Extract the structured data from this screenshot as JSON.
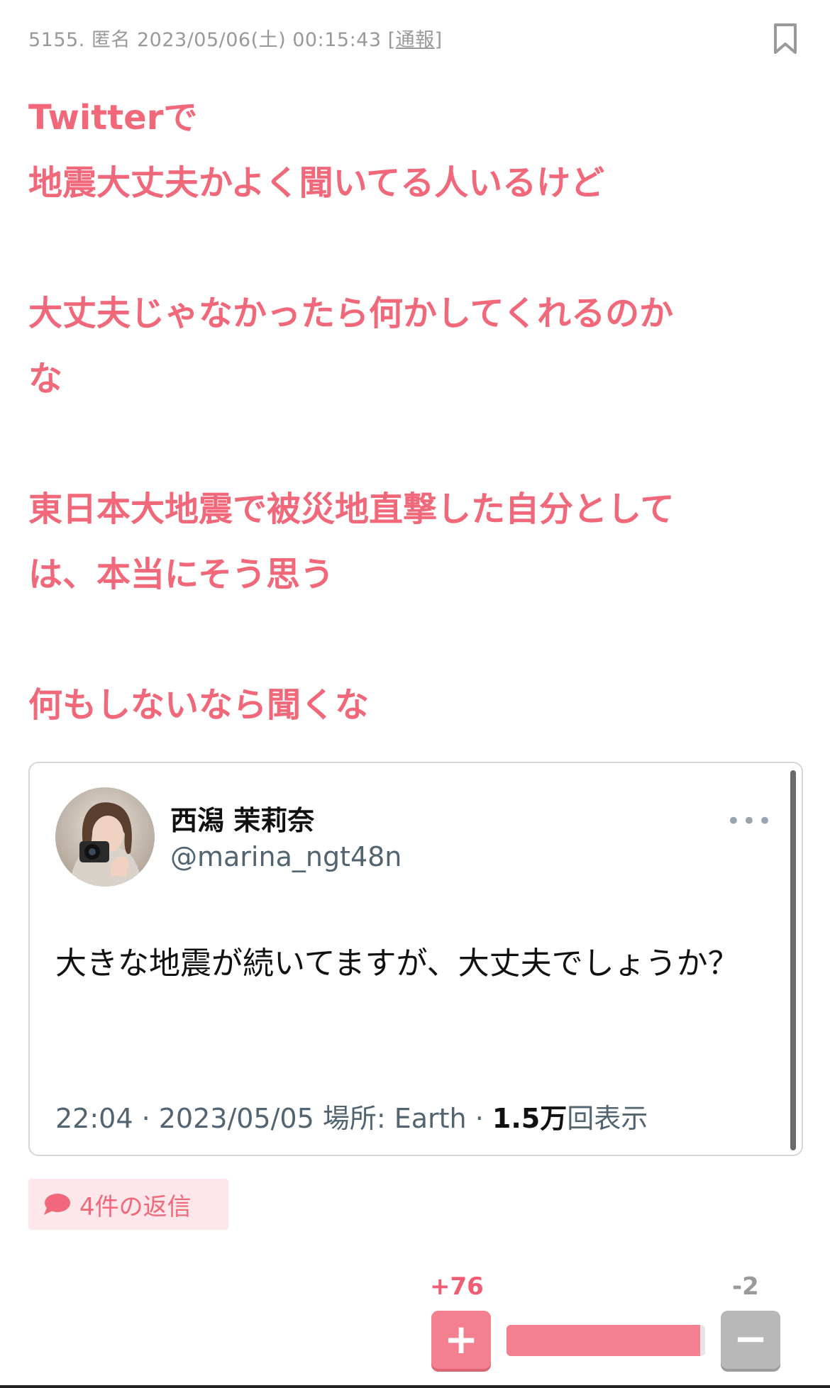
{
  "comment": {
    "number": "5155.",
    "author": "匿名",
    "datetime": "2023/05/06(土) 00:15:43",
    "report_open": "[",
    "report_label": "通報",
    "report_close": "]",
    "body_paragraphs": [
      [
        "Twitterで",
        "地震大丈夫かよく聞いてる人いるけど"
      ],
      [
        "大丈夫じゃなかったら何かしてくれるのか",
        "な"
      ],
      [
        "東日本大地震で被災地直撃した自分として",
        "は、本当にそう思う"
      ],
      [
        "何もしないなら聞くな"
      ]
    ]
  },
  "tweet": {
    "name": "西潟 茉莉奈",
    "handle": "@marina_ngt48n",
    "more_icon": "•••",
    "text": "大きな地震が続いてますが、大丈夫でしょうか？",
    "meta_time": "22:04 · 2023/05/05 場所: Earth · ",
    "meta_views_number": "1.5万",
    "meta_views_label": "回表示"
  },
  "replies": {
    "label": "4件の返信",
    "icon": "speech-bubble-icon"
  },
  "votes": {
    "plus_count": "+76",
    "minus_count": "-2",
    "plus_symbol": "+",
    "minus_symbol": "−",
    "positive_ratio": 0.974
  },
  "colors": {
    "accent": "#f0687a",
    "plus_button": "#f4808f",
    "minus_button": "#b8b8b8",
    "meta_gray": "#999999"
  },
  "icons": {
    "bookmark": "bookmark-icon"
  }
}
